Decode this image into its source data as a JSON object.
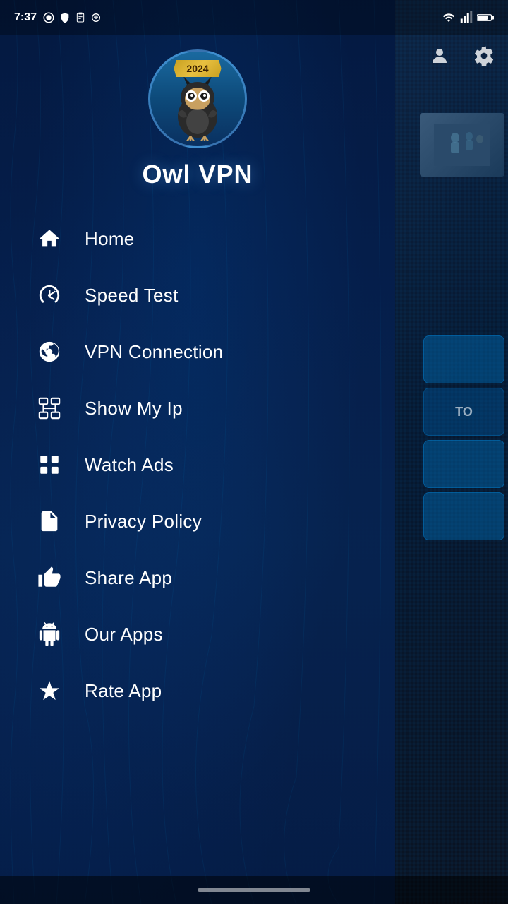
{
  "status_bar": {
    "time": "7:37",
    "icons": [
      "circle-icon",
      "shield-icon",
      "clipboard-icon",
      "share-icon",
      "dot-icon"
    ]
  },
  "app": {
    "name": "Owl VPN",
    "year": "2024"
  },
  "top_icons": {
    "profile_icon": "👤",
    "settings_icon": "⚙"
  },
  "menu": {
    "items": [
      {
        "id": "home",
        "label": "Home",
        "icon": "home"
      },
      {
        "id": "speed-test",
        "label": "Speed Test",
        "icon": "speedometer"
      },
      {
        "id": "vpn-connection",
        "label": "VPN Connection",
        "icon": "vpn"
      },
      {
        "id": "show-my-ip",
        "label": "Show My Ip",
        "icon": "network"
      },
      {
        "id": "watch-ads",
        "label": "Watch Ads",
        "icon": "grid"
      },
      {
        "id": "privacy-policy",
        "label": "Privacy Policy",
        "icon": "document"
      },
      {
        "id": "share-app",
        "label": "Share App",
        "icon": "thumbsup"
      },
      {
        "id": "our-apps",
        "label": "Our Apps",
        "icon": "android"
      },
      {
        "id": "rate-app",
        "label": "Rate App",
        "icon": "star"
      }
    ]
  },
  "right_buttons": [
    "",
    "TO",
    "",
    ""
  ],
  "nav_bar": {
    "pill": true
  }
}
